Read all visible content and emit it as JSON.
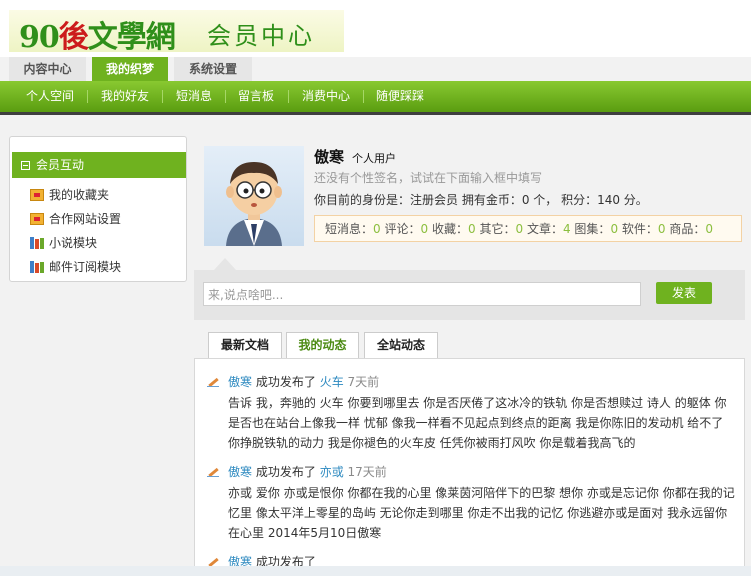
{
  "logo": {
    "mark": "90",
    "mark_accent": "後",
    "brand": "文學網",
    "subtitle": "会员中心"
  },
  "tabs": [
    {
      "label": "内容中心"
    },
    {
      "label": "我的织梦"
    },
    {
      "label": "系统设置"
    }
  ],
  "nav": [
    {
      "label": "个人空间"
    },
    {
      "label": "我的好友"
    },
    {
      "label": "短消息"
    },
    {
      "label": "留言板"
    },
    {
      "label": "消费中心"
    },
    {
      "label": "随便踩踩"
    }
  ],
  "sidebar": {
    "title": "会员互动",
    "items": [
      {
        "label": "我的收藏夹",
        "icon": "folder-icon"
      },
      {
        "label": "合作网站设置",
        "icon": "folder-icon"
      },
      {
        "label": "小说模块",
        "icon": "books-icon"
      },
      {
        "label": "邮件订阅模块",
        "icon": "books-icon"
      }
    ]
  },
  "profile": {
    "name": "傲寒",
    "type": "个人用户",
    "signature": "还没有个性签名，试试在下面输入框中填写",
    "identity": "你目前的身份是：注册会员 拥有金币：0 个， 积分：140 分。",
    "counts": [
      {
        "label": "短消息：",
        "value": "0"
      },
      {
        "label": "评论：",
        "value": "0"
      },
      {
        "label": "收藏：",
        "value": "0"
      },
      {
        "label": "其它：",
        "value": "0"
      },
      {
        "label": "文章：",
        "value": "4"
      },
      {
        "label": "图集：",
        "value": "0"
      },
      {
        "label": "软件：",
        "value": "0"
      },
      {
        "label": "商品：",
        "value": "0"
      }
    ]
  },
  "post": {
    "placeholder": "来,说点啥吧...",
    "button": "发表"
  },
  "feed_tabs": [
    {
      "label": "最新文档"
    },
    {
      "label": "我的动态"
    },
    {
      "label": "全站动态"
    }
  ],
  "feed": [
    {
      "user": "傲寒",
      "action": "成功发布了",
      "title": "火车",
      "time": "7天前",
      "body": "告诉 我，奔驰的 火车 你要到哪里去 你是否厌倦了这冰冷的铁轨 你是否想赎过 诗人 的躯体 你是否也在站台上像我一样 忧郁 像我一样看不见起点到终点的距离 我是你陈旧的发动机 给不了你挣脱铁轨的动力 我是你褪色的火车皮 任凭你被雨打风吹 你是载着我高飞的"
    },
    {
      "user": "傲寒",
      "action": "成功发布了",
      "title": "亦或",
      "time": "17天前",
      "body": "亦或 爱你 亦或是恨你 你都在我的心里 像莱茵河陪伴下的巴黎 想你 亦或是忘记你 你都在我的记忆里 像太平洋上零星的岛屿 无论你走到哪里 你走不出我的记忆 你逃避亦或是面对 我永远留你在心里 2014年5月10日傲寒"
    },
    {
      "user": "傲寒",
      "action": "成功发布了",
      "title": "",
      "time": "",
      "body": ""
    }
  ],
  "colors": {
    "accent": "#6fb21f",
    "link": "#2e8ac0",
    "count_value": "#8cbf3f"
  }
}
